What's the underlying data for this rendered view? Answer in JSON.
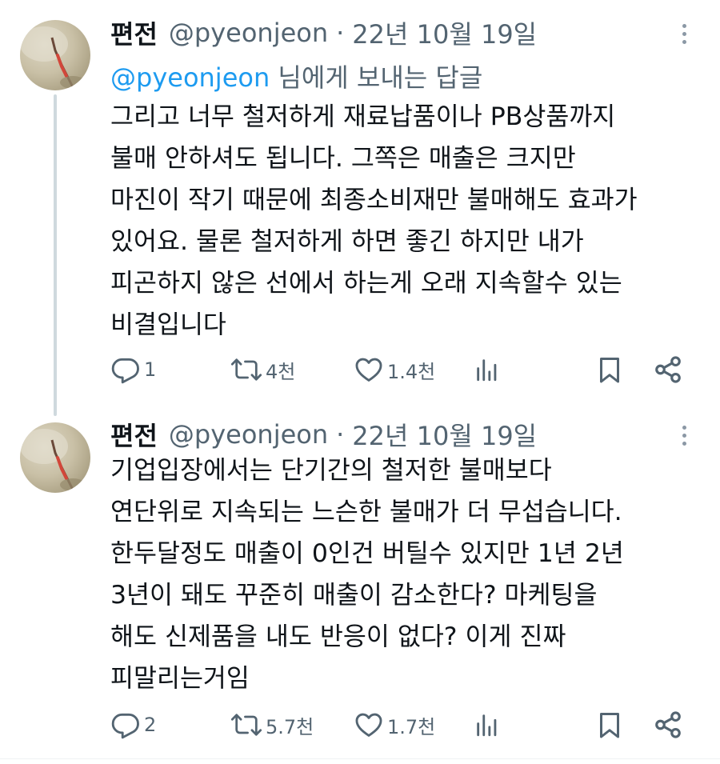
{
  "tweets": [
    {
      "author_name": "편전",
      "handle": "@pyeonjeon",
      "separator": "·",
      "date": "22년 10월 19일",
      "reply_prefix": "@pyeonjeon",
      "reply_suffix": " 님에게 보내는 답글",
      "lines": [
        "그리고 너무 철저하게 재료납품이나 PB상품까지",
        "불매 안하셔도 됩니다. 그쪽은 매출은 크지만",
        "마진이 작기 때문에 최종소비재만 불매해도 효과가",
        "있어요. 물론 철저하게 하면 좋긴 하지만 내가",
        "피곤하지 않은 선에서 하는게 오래 지속할수 있는",
        "비결입니다"
      ],
      "replies": "1",
      "retweets": "4천",
      "likes": "1.4천"
    },
    {
      "author_name": "편전",
      "handle": "@pyeonjeon",
      "separator": "·",
      "date": "22년 10월 19일",
      "lines": [
        "기업입장에서는 단기간의 철저한 불매보다",
        "연단위로 지속되는 느슨한 불매가 더 무섭습니다.",
        "한두달정도 매출이 0인건 버틸수 있지만 1년 2년",
        "3년이 돼도 꾸준히 매출이 감소한다? 마케팅을",
        "해도 신제품을 내도 반응이 없다? 이게 진짜",
        "피말리는거임"
      ],
      "replies": "2",
      "retweets": "5.7천",
      "likes": "1.7천"
    }
  ],
  "icons": {
    "reply": "reply-icon",
    "retweet": "retweet-icon",
    "like": "heart-icon",
    "views": "views-icon",
    "bookmark": "bookmark-icon",
    "share": "share-icon",
    "more": "more-icon"
  },
  "colors": {
    "text": "#0f1419",
    "secondary": "#536471",
    "link": "#1d9bf0",
    "thread_line": "#cfd9de"
  }
}
